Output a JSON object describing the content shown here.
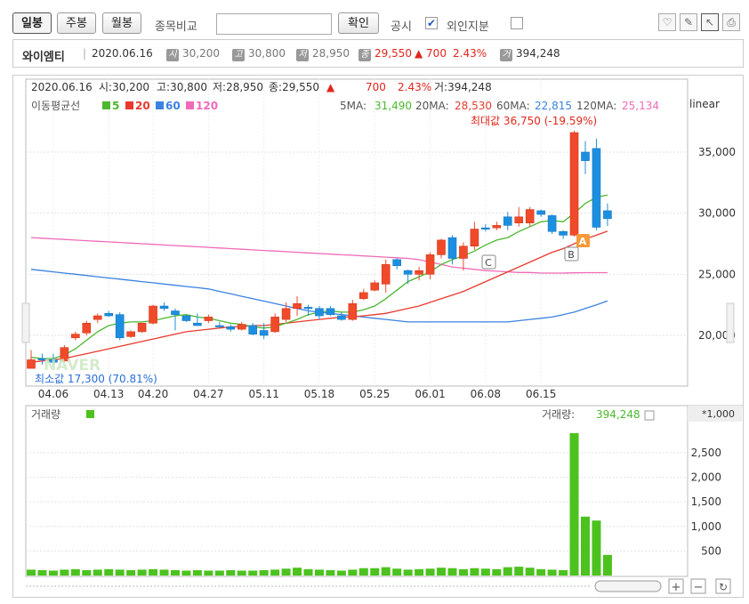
{
  "toolbar": {
    "daily": "일봉",
    "weekly": "주봉",
    "monthly": "월봉",
    "compare_label": "종목비교",
    "confirm": "확인",
    "disclosure": "공시",
    "foreign": "외인지분"
  },
  "info": {
    "name": "와이엠티",
    "date": "2020.06.16",
    "open_badge": "시",
    "open": "30,200",
    "high_badge": "고",
    "high": "30,800",
    "low_badge": "저",
    "low": "28,950",
    "close_badge": "종",
    "close": "29,550",
    "change": "▲ 700",
    "pct": "2.43%",
    "vol_badge": "거",
    "volume": "394,248"
  },
  "header": {
    "date": "2020.06.16",
    "open": "시:30,200",
    "high": "고:30,800",
    "low": "저:28,950",
    "close": "종:29,550",
    "up": "▲",
    "change": "700",
    "pct": "2.43%",
    "volume": "거:394,248",
    "ma_label": "이동평균선",
    "ma5": "5",
    "ma20": "20",
    "ma60": "60",
    "ma120": "120",
    "ma5_label": "5MA:",
    "ma5_val": "31,490",
    "ma20_label": "20MA:",
    "ma20_val": "28,530",
    "ma60_label": "60MA:",
    "ma60_val": "22,815",
    "ma120_label": "120MA:",
    "ma120_val": "25,134",
    "scale": "linear",
    "max_label": "최대값 36,750 (-19.59%)",
    "min_label": "최소값 17,300 (70.81%)",
    "watermark": "NAVER",
    "marker_a": "A",
    "marker_b": "B",
    "marker_c": "C"
  },
  "volume_header": {
    "label": "거래량",
    "right_label": "거래량:",
    "value": "394,248",
    "unit": "*1,000"
  },
  "colors": {
    "up": "#f04a2a",
    "down": "#1d8fe0",
    "ma5": "#4cb82e",
    "ma20": "#e83a2e",
    "ma60": "#3b82e0",
    "ma120": "#f06ab8",
    "volume": "#4cc21f"
  },
  "chart_data": {
    "type": "candlestick",
    "x_ticks": [
      "04.06",
      "04.13",
      "04.20",
      "04.27",
      "05.11",
      "05.18",
      "05.25",
      "06.01",
      "06.08",
      "06.15"
    ],
    "price_ticks": [
      "20,000",
      "25,000",
      "30,000",
      "35,000"
    ],
    "volume_ticks": [
      "500",
      "1,000",
      "1,500",
      "2,000",
      "2,500"
    ],
    "candles": [
      {
        "o": 17300,
        "h": 18800,
        "l": 17300,
        "c": 18000
      },
      {
        "o": 18100,
        "h": 18500,
        "l": 17600,
        "c": 18000
      },
      {
        "o": 18000,
        "h": 18500,
        "l": 17500,
        "c": 17800
      },
      {
        "o": 17900,
        "h": 19200,
        "l": 17800,
        "c": 19000
      },
      {
        "o": 19800,
        "h": 20300,
        "l": 19600,
        "c": 20100
      },
      {
        "o": 20200,
        "h": 21200,
        "l": 20000,
        "c": 21000
      },
      {
        "o": 21300,
        "h": 21800,
        "l": 21000,
        "c": 21600
      },
      {
        "o": 21800,
        "h": 22000,
        "l": 21500,
        "c": 21600
      },
      {
        "o": 21700,
        "h": 21900,
        "l": 19600,
        "c": 19800
      },
      {
        "o": 19900,
        "h": 20400,
        "l": 19800,
        "c": 20300
      },
      {
        "o": 20300,
        "h": 21000,
        "l": 20200,
        "c": 21000
      },
      {
        "o": 21000,
        "h": 22500,
        "l": 20900,
        "c": 22400
      },
      {
        "o": 22400,
        "h": 22700,
        "l": 22000,
        "c": 22200
      },
      {
        "o": 22000,
        "h": 22200,
        "l": 20400,
        "c": 21700
      },
      {
        "o": 21600,
        "h": 21700,
        "l": 21100,
        "c": 21200
      },
      {
        "o": 21000,
        "h": 21800,
        "l": 20800,
        "c": 20800
      },
      {
        "o": 21200,
        "h": 21700,
        "l": 21000,
        "c": 21500
      },
      {
        "o": 20800,
        "h": 21100,
        "l": 20600,
        "c": 20700
      },
      {
        "o": 20700,
        "h": 20900,
        "l": 20300,
        "c": 20500
      },
      {
        "o": 20500,
        "h": 21100,
        "l": 20400,
        "c": 20900
      },
      {
        "o": 20800,
        "h": 21000,
        "l": 20000,
        "c": 20100
      },
      {
        "o": 20400,
        "h": 21000,
        "l": 19700,
        "c": 20000
      },
      {
        "o": 20300,
        "h": 21800,
        "l": 20200,
        "c": 21500
      },
      {
        "o": 21300,
        "h": 22700,
        "l": 21100,
        "c": 22200
      },
      {
        "o": 22200,
        "h": 23200,
        "l": 21600,
        "c": 22600
      },
      {
        "o": 22300,
        "h": 22500,
        "l": 21600,
        "c": 22200
      },
      {
        "o": 22200,
        "h": 22400,
        "l": 21300,
        "c": 21600
      },
      {
        "o": 22200,
        "h": 22400,
        "l": 21600,
        "c": 21700
      },
      {
        "o": 21600,
        "h": 21900,
        "l": 21200,
        "c": 21300
      },
      {
        "o": 21300,
        "h": 22900,
        "l": 21200,
        "c": 22600
      },
      {
        "o": 23000,
        "h": 23800,
        "l": 22900,
        "c": 23500
      },
      {
        "o": 23700,
        "h": 24500,
        "l": 23600,
        "c": 24300
      },
      {
        "o": 24200,
        "h": 26200,
        "l": 23500,
        "c": 25800
      },
      {
        "o": 26200,
        "h": 26300,
        "l": 25400,
        "c": 25700
      },
      {
        "o": 25300,
        "h": 25400,
        "l": 24200,
        "c": 25000
      },
      {
        "o": 25000,
        "h": 25600,
        "l": 24500,
        "c": 25300
      },
      {
        "o": 25000,
        "h": 26800,
        "l": 24600,
        "c": 26600
      },
      {
        "o": 26600,
        "h": 27900,
        "l": 26300,
        "c": 27800
      },
      {
        "o": 28000,
        "h": 28200,
        "l": 25800,
        "c": 26300
      },
      {
        "o": 26300,
        "h": 27600,
        "l": 25300,
        "c": 27300
      },
      {
        "o": 27300,
        "h": 29300,
        "l": 27000,
        "c": 28700
      },
      {
        "o": 28800,
        "h": 29100,
        "l": 28500,
        "c": 28700
      },
      {
        "o": 28800,
        "h": 29300,
        "l": 28600,
        "c": 29000
      },
      {
        "o": 29700,
        "h": 30100,
        "l": 28600,
        "c": 29000
      },
      {
        "o": 29200,
        "h": 30500,
        "l": 28900,
        "c": 29700
      },
      {
        "o": 29200,
        "h": 30500,
        "l": 28900,
        "c": 30300
      },
      {
        "o": 30200,
        "h": 30300,
        "l": 29700,
        "c": 29900
      },
      {
        "o": 29800,
        "h": 29900,
        "l": 28300,
        "c": 28500
      },
      {
        "o": 28500,
        "h": 28600,
        "l": 27900,
        "c": 28200
      },
      {
        "o": 28200,
        "h": 36750,
        "l": 28100,
        "c": 36600
      },
      {
        "o": 35000,
        "h": 35900,
        "l": 33200,
        "c": 34300
      },
      {
        "o": 35300,
        "h": 36100,
        "l": 28600,
        "c": 28850
      },
      {
        "o": 30200,
        "h": 30800,
        "l": 28950,
        "c": 29550
      }
    ],
    "ma5": [
      18200,
      18100,
      18100,
      18400,
      18900,
      19600,
      20300,
      20800,
      21000,
      21100,
      21100,
      21200,
      21400,
      21600,
      21700,
      21500,
      21400,
      21200,
      21000,
      20900,
      20700,
      20600,
      20700,
      21000,
      21300,
      21700,
      21900,
      22000,
      21900,
      21900,
      22100,
      22400,
      23000,
      23700,
      24400,
      24800,
      25200,
      25800,
      26200,
      26500,
      26900,
      27400,
      27800,
      28000,
      28500,
      28900,
      29300,
      29400,
      29300,
      30000,
      30800,
      31300,
      31490
    ],
    "ma20": [
      17800,
      17900,
      18000,
      18100,
      18300,
      18500,
      18700,
      18900,
      19100,
      19300,
      19500,
      19700,
      19900,
      20100,
      20300,
      20400,
      20500,
      20600,
      20700,
      20700,
      20800,
      20800,
      20900,
      21000,
      21100,
      21200,
      21300,
      21400,
      21500,
      21500,
      21600,
      21700,
      21800,
      22000,
      22200,
      22400,
      22700,
      23000,
      23300,
      23600,
      24000,
      24400,
      24800,
      25200,
      25600,
      26000,
      26400,
      26800,
      27100,
      27500,
      27900,
      28200,
      28530
    ],
    "ma60": [
      25400,
      25300,
      25200,
      25100,
      25000,
      24900,
      24800,
      24700,
      24600,
      24500,
      24400,
      24300,
      24200,
      24100,
      24000,
      23900,
      23800,
      23600,
      23400,
      23200,
      23000,
      22800,
      22600,
      22400,
      22200,
      22000,
      21900,
      21800,
      21700,
      21600,
      21500,
      21400,
      21300,
      21200,
      21100,
      21100,
      21100,
      21100,
      21100,
      21100,
      21100,
      21100,
      21100,
      21100,
      21200,
      21300,
      21400,
      21500,
      21700,
      21900,
      22200,
      22500,
      22815
    ],
    "ma120": [
      28000,
      27950,
      27900,
      27850,
      27800,
      27750,
      27700,
      27650,
      27600,
      27550,
      27500,
      27450,
      27400,
      27350,
      27300,
      27250,
      27200,
      27150,
      27100,
      27050,
      27000,
      26950,
      26900,
      26850,
      26800,
      26750,
      26700,
      26650,
      26600,
      26550,
      26500,
      26450,
      26400,
      26350,
      26300,
      26200,
      26000,
      25800,
      25600,
      25500,
      25400,
      25300,
      25250,
      25200,
      25150,
      25150,
      25100,
      25100,
      25100,
      25120,
      25130,
      25134,
      25134
    ],
    "volume": [
      120,
      110,
      100,
      120,
      130,
      110,
      120,
      130,
      120,
      110,
      120,
      130,
      120,
      110,
      100,
      110,
      100,
      100,
      110,
      100,
      100,
      110,
      120,
      140,
      160,
      130,
      120,
      110,
      100,
      120,
      150,
      150,
      170,
      140,
      120,
      130,
      140,
      160,
      150,
      130,
      150,
      140,
      130,
      170,
      180,
      160,
      130,
      120,
      110,
      2900,
      1200,
      1120,
      420
    ]
  }
}
